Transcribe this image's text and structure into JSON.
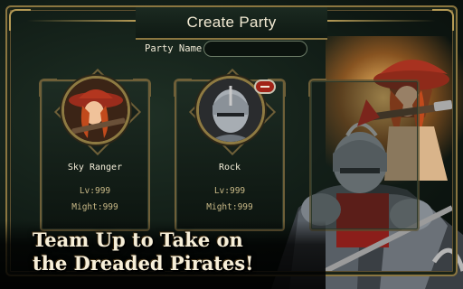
{
  "header": {
    "title": "Create Party"
  },
  "party_name": {
    "label": "Party Name",
    "value": ""
  },
  "members": [
    {
      "name": "Sky Ranger",
      "level": "Lv:999",
      "might": "Might:999"
    },
    {
      "name": "Rock",
      "level": "Lv:999",
      "might": "Might:999"
    }
  ],
  "promo": {
    "line1": "Team Up to Take on",
    "line2": "the Dreaded Pirates!"
  },
  "colors": {
    "frame_gold": "#8b7640",
    "panel_green": "#1b2a21",
    "remove_red": "#a12418",
    "text_cream": "#f3edd8"
  },
  "icons": [
    "remove-member-icon",
    "ranger-portrait",
    "knight-portrait"
  ]
}
